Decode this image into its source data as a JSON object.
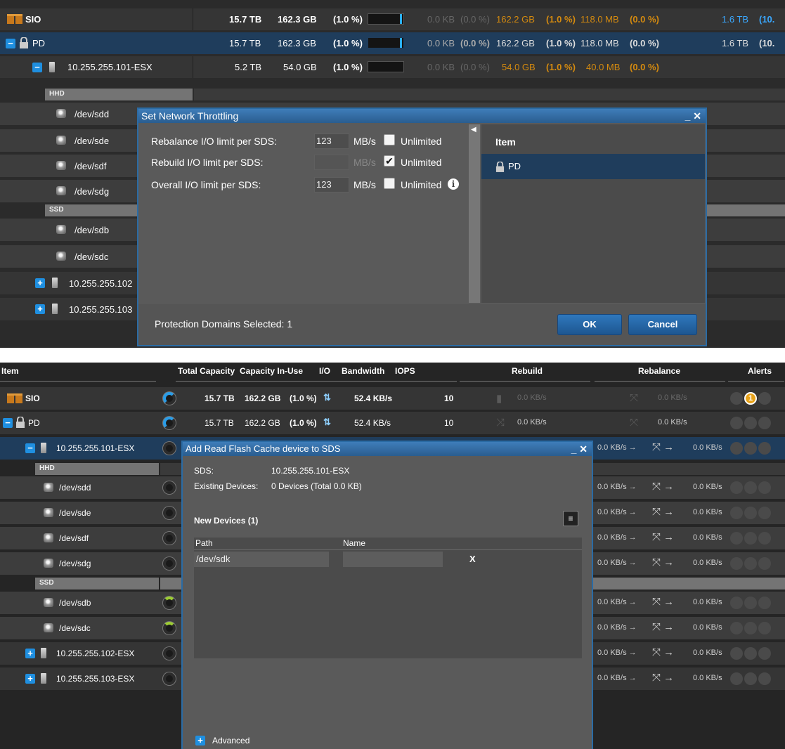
{
  "screen1": {
    "rows": [
      {
        "name": "SIO",
        "total": "15.7 TB",
        "inuse": "162.3 GB",
        "pct": "(1.0 %)",
        "v1": "0.0 KB",
        "p1": "(0.0 %)",
        "v2": "162.2 GB",
        "p2": "(1.0 %)",
        "v3": "118.0 MB",
        "p3": "(0.0 %)",
        "v4": "1.6 TB",
        "p4": "(10."
      },
      {
        "name": "PD",
        "total": "15.7 TB",
        "inuse": "162.3 GB",
        "pct": "(1.0 %)",
        "v1": "0.0 KB",
        "p1": "(0.0 %)",
        "v2": "162.2 GB",
        "p2": "(1.0 %)",
        "v3": "118.0 MB",
        "p3": "(0.0 %)",
        "v4": "1.6 TB",
        "p4": "(10."
      },
      {
        "name": "10.255.255.101-ESX",
        "total": "5.2 TB",
        "inuse": "54.0 GB",
        "pct": "(1.0 %)",
        "v1": "0.0 KB",
        "p1": "(0.0 %)",
        "v2": "54.0 GB",
        "p2": "(1.0 %)",
        "v3": "40.0 MB",
        "p3": "(0.0 %)"
      }
    ],
    "hhd_label": "HHD",
    "ssd_label": "SSD",
    "hhd_devices": [
      "/dev/sdd",
      "/dev/sde",
      "/dev/sdf",
      "/dev/sdg"
    ],
    "ssd_devices": [
      "/dev/sdb",
      "/dev/sdc"
    ],
    "servers": [
      "10.255.255.102",
      "10.255.255.103"
    ],
    "dialog": {
      "title": "Set Network Throttling",
      "ctrl": "_ ✕",
      "rebalance_label": "Rebalance I/O limit per SDS:",
      "rebalance_value": "123",
      "rebuild_label": "Rebuild I/O limit per SDS:",
      "rebuild_value": "",
      "overall_label": "Overall I/O limit per SDS:",
      "overall_value": "123",
      "unit": "MB/s",
      "unlimited": "Unlimited",
      "rebalance_unlimited": false,
      "rebuild_unlimited": true,
      "overall_unlimited": false,
      "item_header": "Item",
      "item": "PD",
      "footer": "Protection Domains Selected: 1",
      "ok": "OK",
      "cancel": "Cancel"
    }
  },
  "screen2": {
    "headers": {
      "item": "Item",
      "total": "Total Capacity",
      "inuse": "Capacity In-Use",
      "io": "I/O",
      "bandwidth": "Bandwidth",
      "iops": "IOPS",
      "rebuild": "Rebuild",
      "rebalance": "Rebalance",
      "alerts": "Alerts"
    },
    "rows": [
      {
        "name": "SIO",
        "total": "15.7 TB",
        "inuse": "162.2 GB",
        "pct": "(1.0 %)",
        "bw": "52.4 KB/s",
        "iops": "10",
        "rebuild": "0.0 KB/s",
        "rebalance": "0.0 KB/s",
        "alert": "1"
      },
      {
        "name": "PD",
        "total": "15.7 TB",
        "inuse": "162.2 GB",
        "pct": "(1.0 %)",
        "bw": "52.4 KB/s",
        "iops": "10",
        "rebuild": "0.0 KB/s",
        "rebalance": "0.0 KB/s"
      },
      {
        "name": "10.255.255.101-ESX"
      }
    ],
    "hhd_label": "HHD",
    "ssd_label": "SSD",
    "hhd_devices": [
      "/dev/sdd",
      "/dev/sde",
      "/dev/sdf",
      "/dev/sdg"
    ],
    "ssd_devices": [
      "/dev/sdb",
      "/dev/sdc"
    ],
    "servers": [
      "10.255.255.102-ESX",
      "10.255.255.103-ESX"
    ],
    "rate": "0.0 KB/s",
    "dialog": {
      "title": "Add Read Flash Cache device to SDS",
      "ctrl": "_ ✕",
      "sds_label": "SDS:",
      "sds_value": "10.255.255.101-ESX",
      "existing_label": "Existing Devices:",
      "existing_value": "0 Devices (Total 0.0 KB)",
      "new_devices": "New Devices (1)",
      "col_path": "Path",
      "col_name": "Name",
      "path_value": "/dev/sdk",
      "name_value": "",
      "remove": "X",
      "advanced": "Advanced"
    }
  }
}
